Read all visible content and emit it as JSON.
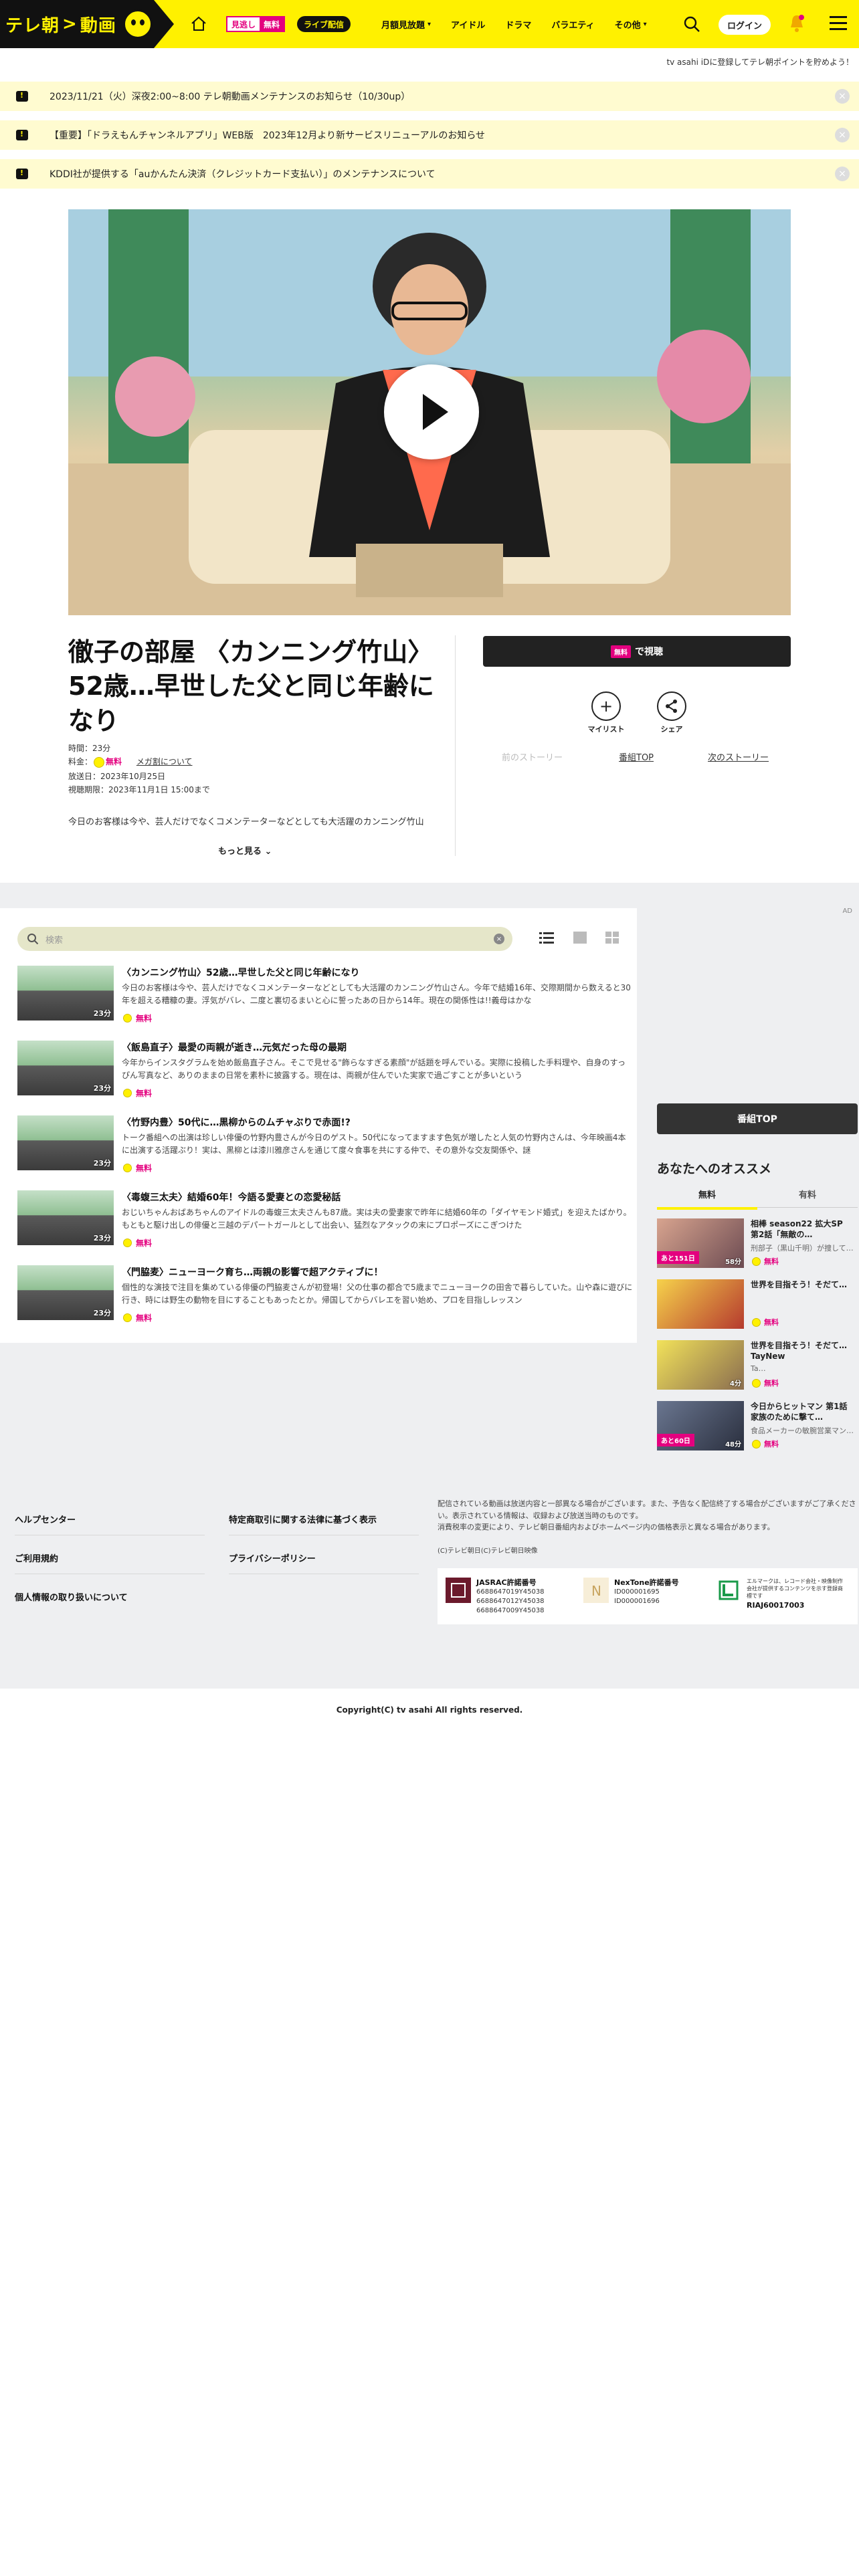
{
  "header": {
    "logo_text": "テレ朝",
    "logo_text2": "動画",
    "free_badge_a": "見逃し",
    "free_badge_b": "無料",
    "live_badge": "ライブ配信",
    "nav": [
      {
        "label": "月額見放題",
        "has_menu": true
      },
      {
        "label": "アイドル",
        "has_menu": false
      },
      {
        "label": "ドラマ",
        "has_menu": false
      },
      {
        "label": "バラエティ",
        "has_menu": false
      },
      {
        "label": "その他",
        "has_menu": true
      }
    ],
    "login_label": "ログイン",
    "sub_promo": "tv asahi iDに登録してテレ朝ポイントを貯めよう！"
  },
  "notices": [
    "2023/11/21（火）深夜2:00~8:00 テレ朝動画メンテナンスのお知らせ（10/30up）",
    "【重要】「ドラえもんチャンネルアプリ」WEB版　2023年12月より新サービスリニューアルのお知らせ",
    "KDDI社が提供する「auかんたん決済（クレジットカード支払い）」のメンテナンスについて"
  ],
  "program": {
    "title": "徹子の部屋 〈カンニング竹山〉52歳…早世した父と同じ年齢になり",
    "time_label": "時間：23分",
    "price_label": "料金：",
    "price_free": "無料",
    "mega_link": "メガ割について",
    "aired": "放送日：2023年10月25日",
    "expires": "視聴期限：2023年11月1日 15:00まで",
    "desc": "今日のお客様は今や、芸人だけでなくコメンテーターなどとしても大活躍のカンニング竹山",
    "more_label": "もっと見る",
    "watch_free": "無料",
    "watch_label": "で視聴",
    "mylist_label": "マイリスト",
    "share_label": "シェア",
    "prev_story": "前のストーリー",
    "program_top": "番組TOP",
    "next_story": "次のストーリー"
  },
  "episodes": {
    "search_placeholder": "検索",
    "items": [
      {
        "title": "〈カンニング竹山〉52歳…早世した父と同じ年齢になり",
        "desc": "今日のお客様は今や、芸人だけでなくコメンテーターなどとしても大活躍のカンニング竹山さん。今年で結婚16年、交際期間から数えると30年を超える糟糠の妻。浮気がバレ、二度と裏切るまいと心に誓ったあの日から14年。現在の関係性は!!義母はかな",
        "duration": "23分",
        "free": "無料"
      },
      {
        "title": "〈飯島直子〉最愛の両親が逝き…元気だった母の最期",
        "desc": "今年からインスタグラムを始め飯島直子さん。そこで見せる\"飾らなすぎる素顔\"が話題を呼んでいる。実際に投稿した手料理や、自身のすっぴん写真など、ありのままの日常を素朴に披露する。現在は、両親が住んでいた実家で過ごすことが多いという",
        "duration": "23分",
        "free": "無料"
      },
      {
        "title": "〈竹野内豊〉50代に…黒柳からのムチャぶりで赤面!?",
        "desc": "トーク番組への出演は珍しい俳優の竹野内豊さんが今日のゲスト。50代になってますます色気が増したと人気の竹野内さんは、今年映画4本に出演する活躍ぶり！実は、黒柳とは漆川雅彦さんを通じて度々食事を共にする仲で、その意外な交友関係や、謎",
        "duration": "23分",
        "free": "無料"
      },
      {
        "title": "〈毒蝮三太夫〉結婚60年！今語る愛妻との恋愛秘話",
        "desc": "おじいちゃんおばあちゃんのアイドルの毒蝮三太夫さんも87歳。実は夫の愛妻家で昨年に結婚60年の「ダイヤモンド婚式」を迎えたばかり。もともと駆け出しの俳優と三越のデパートガールとして出会い、猛烈なアタックの末にプロポーズにこぎつけた",
        "duration": "23分",
        "free": "無料"
      },
      {
        "title": "〈門脇麦〉ニューヨーク育ち…両親の影響で超アクティブに！",
        "desc": "個性的な演技で注目を集めている俳優の門脇麦さんが初登場！父の仕事の都合で5歳までニューヨークの田舎で暮らしていた。山や森に遊びに行き、時には野生の動物を目にすることもあったとか。帰国してからバレエを習い始め、プロを目指しレッスン",
        "duration": "23分",
        "free": "無料"
      }
    ]
  },
  "sidebar": {
    "ad_label": "AD",
    "program_top_btn": "番組TOP",
    "heading": "あなたへのオススメ",
    "tab_free": "無料",
    "tab_paid": "有料",
    "items": [
      {
        "title": "相棒 season22 拡大SP　第2話「無敵の…",
        "desc": "刑部子（黒山千明）が捜して…",
        "badge": "あと151日",
        "duration": "58分",
        "free": "無料"
      },
      {
        "title": "世界を目指そう！そだて…",
        "desc": "",
        "badge": "",
        "duration": "",
        "free": "無料"
      },
      {
        "title": "世界を目指そう！そだて… TayNew",
        "desc": "Ta…",
        "badge": "",
        "duration": "4分",
        "free": "無料"
      },
      {
        "title": "今日からヒットマン 第1話 家族のために撃て…",
        "desc": "食品メーカーの敏腕営業マン…",
        "badge": "あと60日",
        "duration": "48分",
        "free": "無料"
      }
    ]
  },
  "footer": {
    "links_col1": [
      "ヘルプセンター",
      "ご利用規約",
      "個人情報の取り扱いについて"
    ],
    "links_col2": [
      "特定商取引に関する法律に基づく表示",
      "プライバシーポリシー"
    ],
    "note": "配信されている動画は放送内容と一部異なる場合がございます。また、予告なく配信終了する場合がございますがご了承ください。表示されている情報は、収録および放送当時のものです。\n消費税率の変更により、テレビ朝日番組内およびホームページ内の価格表示と異なる場合があります。",
    "copyright_small": "(C)テレビ朝日(C)テレビ朝日映像",
    "jasrac_title": "JASRAC許諾番号",
    "jasrac_nums": "6688647019Y45038\n6688647012Y45038\n6688647009Y45038",
    "nextone_title": "NexTone許諾番号",
    "nextone_nums": "ID000001695\nID000001696",
    "lmark_text": "エルマークは、レコード会社・映像制作会社が提供するコンテンツを示す登録商標です",
    "lmark_num": "RIAJ60017003",
    "copyright": "Copyright(C) tv asahi All rights reserved."
  }
}
